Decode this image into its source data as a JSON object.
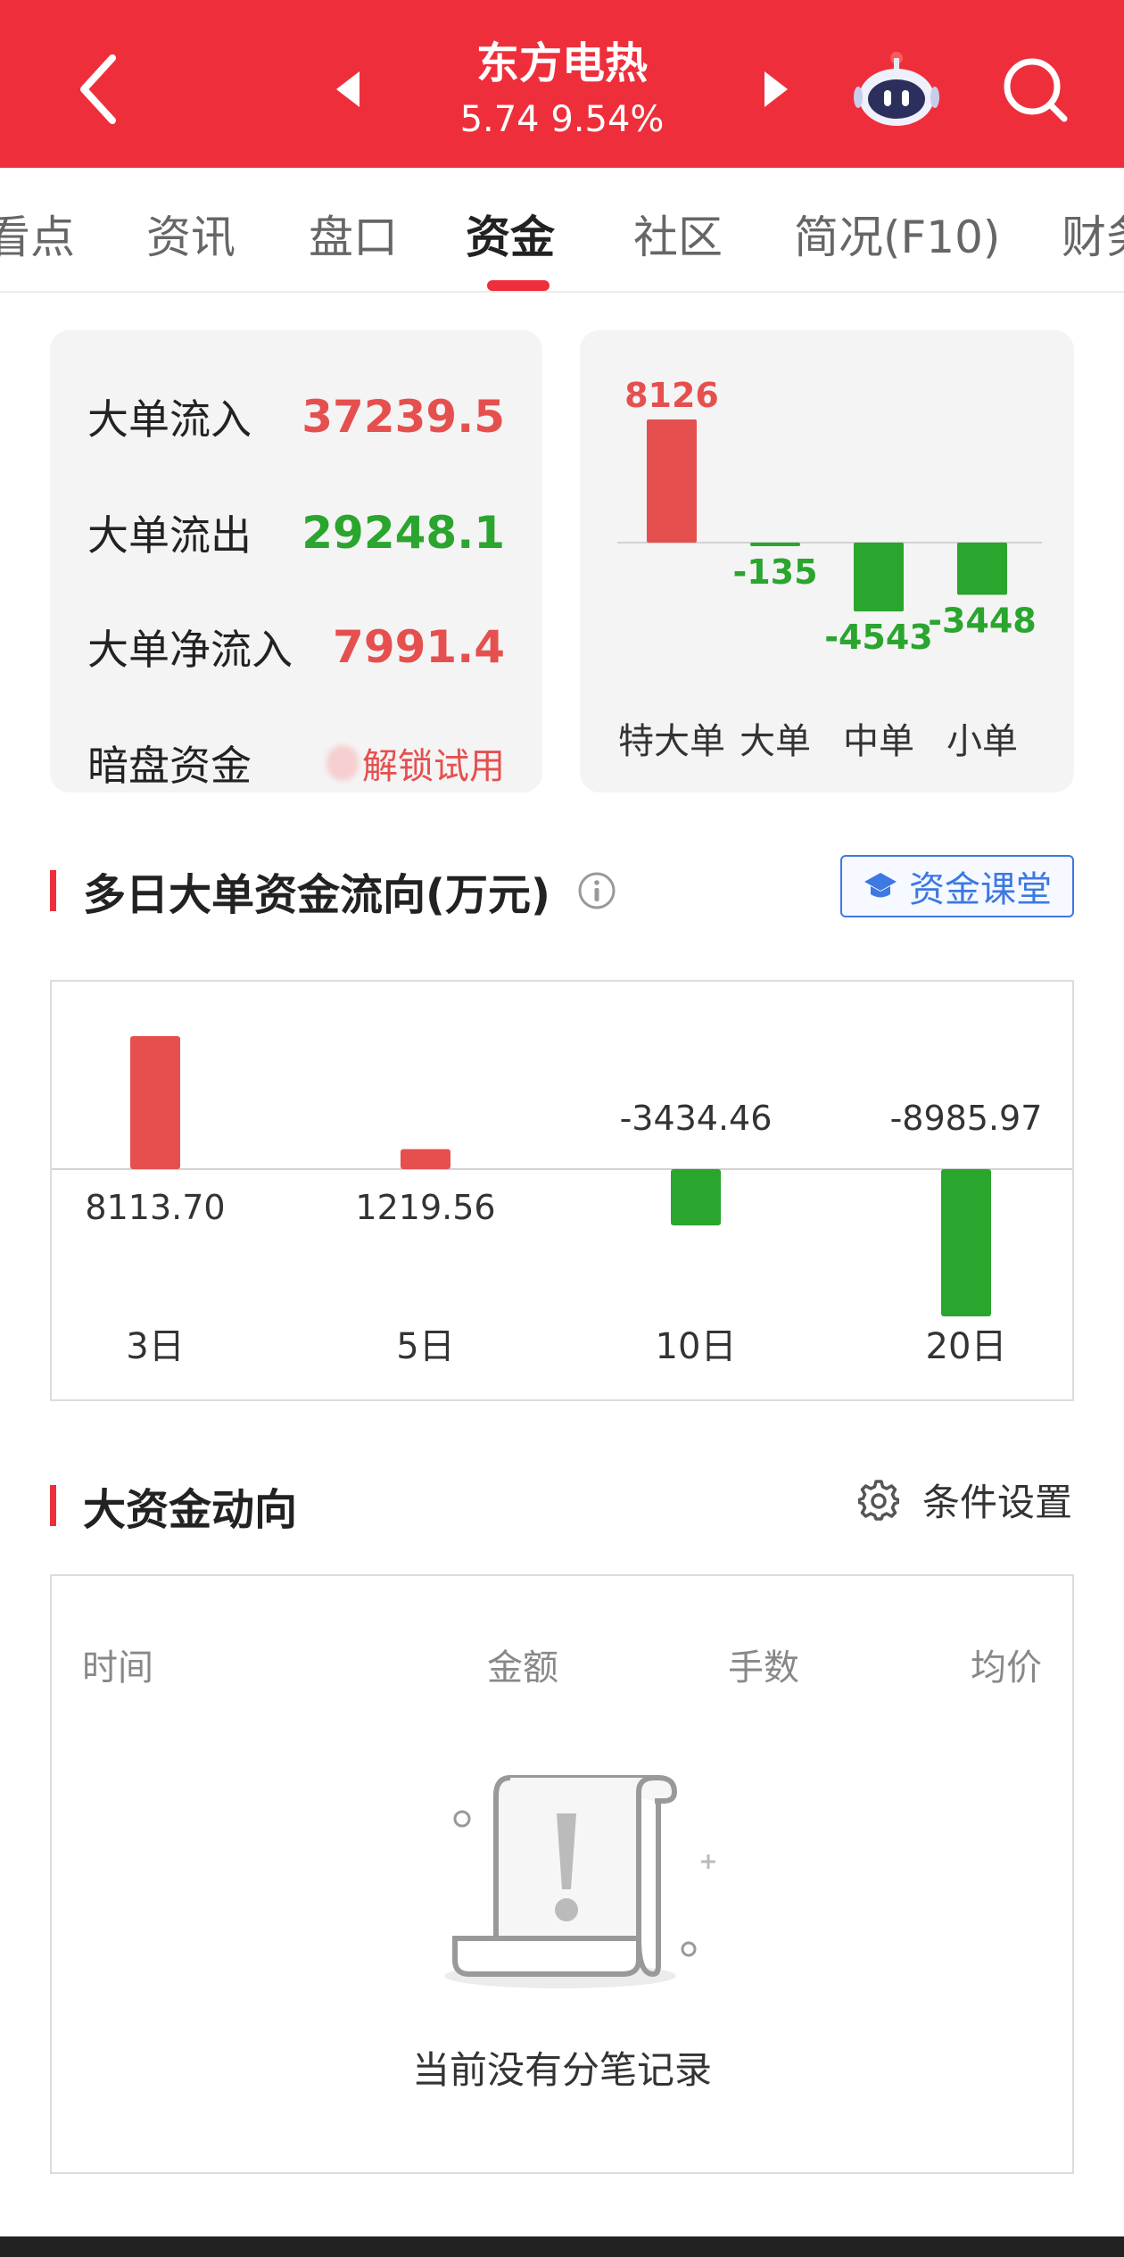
{
  "header": {
    "stock_name": "东方电热",
    "price_change": "5.74 9.54%",
    "accent": "#ee2f3b",
    "icons": [
      "back-arrow-icon",
      "prev-stock-icon",
      "next-stock-icon",
      "robot-assistant-icon",
      "search-icon"
    ]
  },
  "tabs": [
    {
      "label": "看点"
    },
    {
      "label": "资讯"
    },
    {
      "label": "盘口"
    },
    {
      "label": "资金"
    },
    {
      "label": "社区"
    },
    {
      "label": "简况(F10)"
    },
    {
      "label": "财务"
    }
  ],
  "active_tab": "资金",
  "flow_summary": {
    "rows": [
      {
        "label": "大单流入",
        "value": "37239.5",
        "color": "#e5504f"
      },
      {
        "label": "大单流出",
        "value": "29248.1",
        "color": "#2aa52e"
      },
      {
        "label": "大单净流入",
        "value": "7991.4",
        "color": "#e5504f"
      }
    ],
    "dark_pool": {
      "label": "暗盘资金",
      "action": "解锁试用"
    }
  },
  "colors": {
    "up": "#e5504f",
    "down": "#2aa52e",
    "link": "#3d78e3"
  },
  "order_size_chart_labels": {
    "values": [
      "8126",
      "-135",
      "-4543",
      "-3448"
    ],
    "categories": [
      "特大单",
      "大单",
      "中单",
      "小单"
    ]
  },
  "multi_day": {
    "title": "多日大单资金流向(万元)",
    "info_icon": "info-icon",
    "course_button": "资金课堂",
    "course_icon": "graduation-cap-icon",
    "value_labels": [
      "8113.70",
      "1219.56",
      "-3434.46",
      "-8985.97"
    ],
    "categories": [
      "3日",
      "5日",
      "10日",
      "20日"
    ]
  },
  "big_money": {
    "title": "大资金动向",
    "settings_label": "条件设置",
    "settings_icon": "gear-icon",
    "columns": [
      "时间",
      "金额",
      "手数",
      "均价"
    ],
    "empty_message": "当前没有分笔记录",
    "empty_icon": "empty-scroll-icon"
  },
  "chart_data": [
    {
      "type": "bar",
      "categories": [
        "特大单",
        "大单",
        "中单",
        "小单"
      ],
      "values": [
        8126,
        -135,
        -4543,
        -3448
      ]
    },
    {
      "type": "bar",
      "title": "多日大单资金流向(万元)",
      "categories": [
        "3日",
        "5日",
        "10日",
        "20日"
      ],
      "values": [
        8113.7,
        1219.56,
        -3434.46,
        -8985.97
      ]
    }
  ]
}
